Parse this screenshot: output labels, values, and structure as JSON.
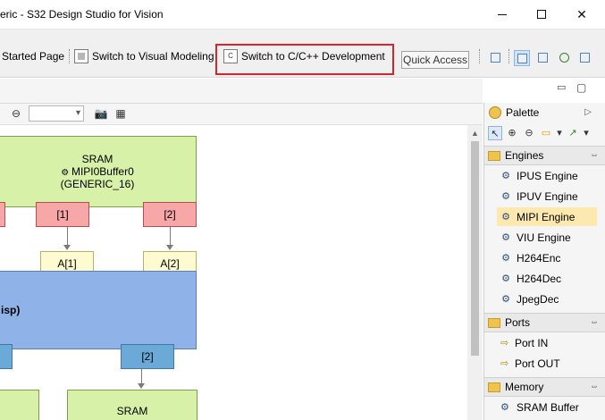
{
  "window": {
    "title": "eric - S32 Design Studio for Vision",
    "minimize": "",
    "maximize": "",
    "close": "✕"
  },
  "toolbar": {
    "started_page": "Started Page",
    "visual_modeling": "Switch to Visual Modeling",
    "cpp_development": "Switch to C/C++ Development",
    "cpp_icon_text": "C",
    "quick_access": "Quick Access",
    "highlight_color": "#d8252b"
  },
  "editor": {
    "minimize": "▭",
    "maximize": "▢",
    "zoom_out_icon": "⊖",
    "zoom_value": "",
    "zoom_arrow": "▾",
    "camera_icon": "📷",
    "grid_icon": "▦",
    "scroll_up": "▲"
  },
  "diagram": {
    "sram_top": {
      "title": "SRAM",
      "name": "MIPI0Buffer0",
      "type": "(GENERIC_16)"
    },
    "out_port_1": "[1]",
    "out_port_2": "[2]",
    "in_port_1": "A[1]",
    "in_port_2": "A[2]",
    "engine_label": "isp)",
    "engine_out_port": "[2]",
    "sram_bottom": {
      "title": "SRAM"
    },
    "colors": {
      "sram": "#d7f1a9",
      "port_out": "#f7a7a7",
      "port_in": "#fffbd0",
      "engine": "#8fb3e8",
      "engine_port": "#6aa9d8"
    }
  },
  "palette": {
    "title": "Palette",
    "collapse": "▷",
    "tools": [
      "↖",
      "⊕",
      "⊖",
      "▭",
      "▾",
      "↗",
      "▾"
    ],
    "engines_drawer": "Engines",
    "engines": [
      "IPUS Engine",
      "IPUV Engine",
      "MIPI Engine",
      "VIU Engine",
      "H264Enc",
      "H264Dec",
      "JpegDec"
    ],
    "selected_engine": "MIPI Engine",
    "ports_drawer": "Ports",
    "ports": [
      "Port IN",
      "Port OUT"
    ],
    "memory_drawer": "Memory",
    "memory": [
      "SRAM Buffer"
    ],
    "pin_icon": "⇔",
    "gear_glyph": "⚙",
    "port_glyph": "⇨",
    "memory_glyph": "⚙",
    "selected_color": "#fde9b0"
  }
}
